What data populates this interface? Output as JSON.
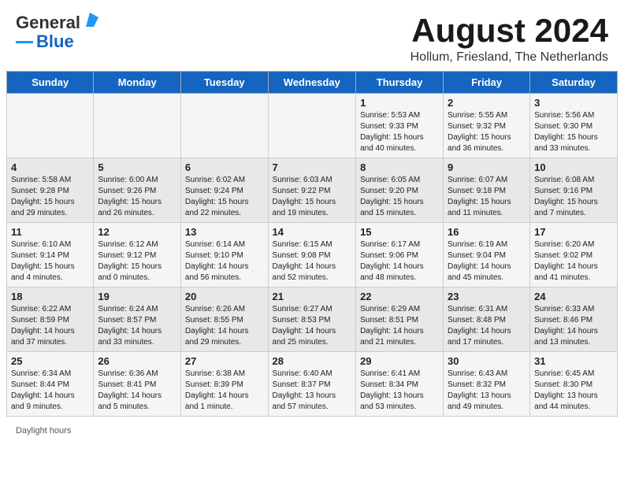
{
  "header": {
    "logo_general": "General",
    "logo_blue": "Blue",
    "month_year": "August 2024",
    "location": "Hollum, Friesland, The Netherlands"
  },
  "days_of_week": [
    "Sunday",
    "Monday",
    "Tuesday",
    "Wednesday",
    "Thursday",
    "Friday",
    "Saturday"
  ],
  "weeks": [
    [
      {
        "day": "",
        "content": ""
      },
      {
        "day": "",
        "content": ""
      },
      {
        "day": "",
        "content": ""
      },
      {
        "day": "",
        "content": ""
      },
      {
        "day": "1",
        "content": "Sunrise: 5:53 AM\nSunset: 9:33 PM\nDaylight: 15 hours\nand 40 minutes."
      },
      {
        "day": "2",
        "content": "Sunrise: 5:55 AM\nSunset: 9:32 PM\nDaylight: 15 hours\nand 36 minutes."
      },
      {
        "day": "3",
        "content": "Sunrise: 5:56 AM\nSunset: 9:30 PM\nDaylight: 15 hours\nand 33 minutes."
      }
    ],
    [
      {
        "day": "4",
        "content": "Sunrise: 5:58 AM\nSunset: 9:28 PM\nDaylight: 15 hours\nand 29 minutes."
      },
      {
        "day": "5",
        "content": "Sunrise: 6:00 AM\nSunset: 9:26 PM\nDaylight: 15 hours\nand 26 minutes."
      },
      {
        "day": "6",
        "content": "Sunrise: 6:02 AM\nSunset: 9:24 PM\nDaylight: 15 hours\nand 22 minutes."
      },
      {
        "day": "7",
        "content": "Sunrise: 6:03 AM\nSunset: 9:22 PM\nDaylight: 15 hours\nand 19 minutes."
      },
      {
        "day": "8",
        "content": "Sunrise: 6:05 AM\nSunset: 9:20 PM\nDaylight: 15 hours\nand 15 minutes."
      },
      {
        "day": "9",
        "content": "Sunrise: 6:07 AM\nSunset: 9:18 PM\nDaylight: 15 hours\nand 11 minutes."
      },
      {
        "day": "10",
        "content": "Sunrise: 6:08 AM\nSunset: 9:16 PM\nDaylight: 15 hours\nand 7 minutes."
      }
    ],
    [
      {
        "day": "11",
        "content": "Sunrise: 6:10 AM\nSunset: 9:14 PM\nDaylight: 15 hours\nand 4 minutes."
      },
      {
        "day": "12",
        "content": "Sunrise: 6:12 AM\nSunset: 9:12 PM\nDaylight: 15 hours\nand 0 minutes."
      },
      {
        "day": "13",
        "content": "Sunrise: 6:14 AM\nSunset: 9:10 PM\nDaylight: 14 hours\nand 56 minutes."
      },
      {
        "day": "14",
        "content": "Sunrise: 6:15 AM\nSunset: 9:08 PM\nDaylight: 14 hours\nand 52 minutes."
      },
      {
        "day": "15",
        "content": "Sunrise: 6:17 AM\nSunset: 9:06 PM\nDaylight: 14 hours\nand 48 minutes."
      },
      {
        "day": "16",
        "content": "Sunrise: 6:19 AM\nSunset: 9:04 PM\nDaylight: 14 hours\nand 45 minutes."
      },
      {
        "day": "17",
        "content": "Sunrise: 6:20 AM\nSunset: 9:02 PM\nDaylight: 14 hours\nand 41 minutes."
      }
    ],
    [
      {
        "day": "18",
        "content": "Sunrise: 6:22 AM\nSunset: 8:59 PM\nDaylight: 14 hours\nand 37 minutes."
      },
      {
        "day": "19",
        "content": "Sunrise: 6:24 AM\nSunset: 8:57 PM\nDaylight: 14 hours\nand 33 minutes."
      },
      {
        "day": "20",
        "content": "Sunrise: 6:26 AM\nSunset: 8:55 PM\nDaylight: 14 hours\nand 29 minutes."
      },
      {
        "day": "21",
        "content": "Sunrise: 6:27 AM\nSunset: 8:53 PM\nDaylight: 14 hours\nand 25 minutes."
      },
      {
        "day": "22",
        "content": "Sunrise: 6:29 AM\nSunset: 8:51 PM\nDaylight: 14 hours\nand 21 minutes."
      },
      {
        "day": "23",
        "content": "Sunrise: 6:31 AM\nSunset: 8:48 PM\nDaylight: 14 hours\nand 17 minutes."
      },
      {
        "day": "24",
        "content": "Sunrise: 6:33 AM\nSunset: 8:46 PM\nDaylight: 14 hours\nand 13 minutes."
      }
    ],
    [
      {
        "day": "25",
        "content": "Sunrise: 6:34 AM\nSunset: 8:44 PM\nDaylight: 14 hours\nand 9 minutes."
      },
      {
        "day": "26",
        "content": "Sunrise: 6:36 AM\nSunset: 8:41 PM\nDaylight: 14 hours\nand 5 minutes."
      },
      {
        "day": "27",
        "content": "Sunrise: 6:38 AM\nSunset: 8:39 PM\nDaylight: 14 hours\nand 1 minute."
      },
      {
        "day": "28",
        "content": "Sunrise: 6:40 AM\nSunset: 8:37 PM\nDaylight: 13 hours\nand 57 minutes."
      },
      {
        "day": "29",
        "content": "Sunrise: 6:41 AM\nSunset: 8:34 PM\nDaylight: 13 hours\nand 53 minutes."
      },
      {
        "day": "30",
        "content": "Sunrise: 6:43 AM\nSunset: 8:32 PM\nDaylight: 13 hours\nand 49 minutes."
      },
      {
        "day": "31",
        "content": "Sunrise: 6:45 AM\nSunset: 8:30 PM\nDaylight: 13 hours\nand 44 minutes."
      }
    ]
  ],
  "footer": {
    "daylight_hours": "Daylight hours"
  }
}
